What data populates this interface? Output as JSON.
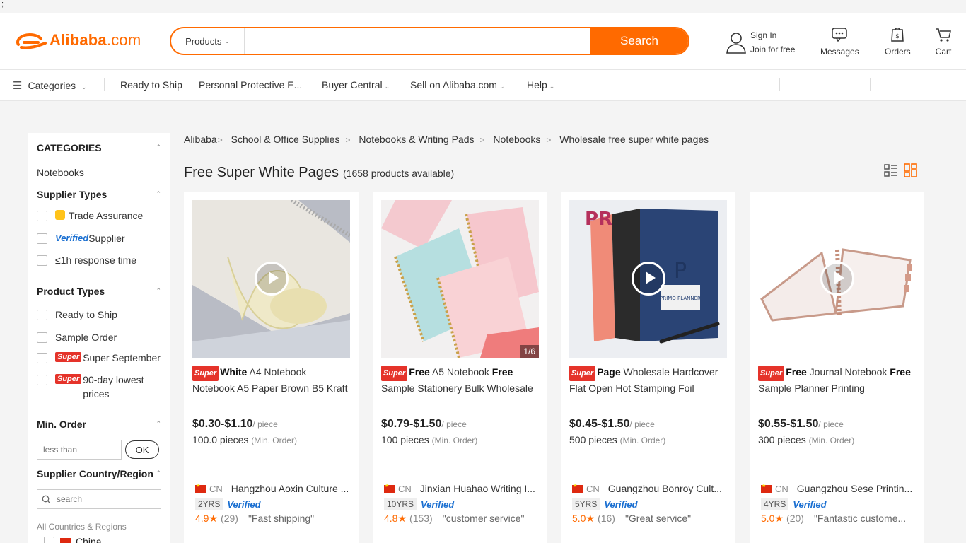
{
  "top_strip": ";",
  "header": {
    "logo_text": "Alibaba",
    "logo_suffix": ".com",
    "search_category": "Products",
    "search_value": "",
    "search_button": "Search",
    "sign_in": "Sign In",
    "join": "Join for free",
    "messages": "Messages",
    "orders": "Orders",
    "cart": "Cart"
  },
  "nav": {
    "categories": "Categories",
    "items": [
      "Ready to Ship",
      "Personal Protective E...",
      "Buyer Central",
      "Sell on Alibaba.com",
      "Help"
    ]
  },
  "sidebar": {
    "categories_title": "CATEGORIES",
    "category_item": "Notebooks",
    "supplier_types_title": "Supplier Types",
    "supplier_types": {
      "trade_assurance": "Trade Assurance",
      "verified_word": "Verified",
      "supplier": " Supplier",
      "response": "≤1h response time"
    },
    "product_types_title": "Product Types",
    "product_types": {
      "ready": "Ready to Ship",
      "sample": "Sample Order",
      "super_tag": "Super",
      "super_sept": "Super September",
      "lowest": "90-day lowest prices"
    },
    "min_order_title": "Min. Order",
    "min_order_placeholder": "less than",
    "ok": "OK",
    "country_title": "Supplier Country/Region",
    "country_placeholder": "search",
    "all_countries": "All Countries & Regions",
    "china": "China"
  },
  "breadcrumb": {
    "root": "Alibaba",
    "items": [
      "School & Office Supplies",
      "Notebooks & Writing Pads",
      "Notebooks",
      "Wholesale free super white pages"
    ]
  },
  "page": {
    "title": "Free Super White Pages",
    "count": "(1658 products available)"
  },
  "colors": {
    "accent": "#ff6a00",
    "super_red": "#e5332a",
    "verified_blue": "#1a6fd1"
  },
  "products": [
    {
      "super_tag": "Super",
      "title_bold": "White",
      "title_rest": " A4 Notebook Notebook A5 Paper Brown B5 Kraft",
      "price": "$0.30-$1.10",
      "unit": "/ piece",
      "moq": "100.0 pieces",
      "moq_label": "(Min. Order)",
      "country": "CN",
      "supplier": "Hangzhou Aoxin Culture ...",
      "years": "2YRS",
      "verified": "Verified",
      "score": "4.9",
      "reviews": "(29)",
      "quote": "\"Fast shipping\"",
      "page_indicator": ""
    },
    {
      "super_tag": "Super",
      "title_bold": "Free",
      "title_rest": " A5 Notebook ",
      "title_bold2": "Free",
      "title_rest2": " Sample Stationery Bulk Wholesale",
      "price": "$0.79-$1.50",
      "unit": "/ piece",
      "moq": "100 pieces",
      "moq_label": "(Min. Order)",
      "country": "CN",
      "supplier": "Jinxian Huahao Writing I...",
      "years": "10YRS",
      "verified": "Verified",
      "score": "4.8",
      "reviews": "(153)",
      "quote": "\"customer service\"",
      "page_indicator": "1/6"
    },
    {
      "super_tag": "Super",
      "title_bold": "Page",
      "title_rest": " Wholesale Hardcover Flat Open Hot Stamping Foil",
      "price": "$0.45-$1.50",
      "unit": "/ piece",
      "moq": "500 pieces",
      "moq_label": "(Min. Order)",
      "country": "CN",
      "supplier": "Guangzhou Bonroy Cult...",
      "years": "5YRS",
      "verified": "Verified",
      "score": "5.0",
      "reviews": "(16)",
      "quote": "\"Great service\"",
      "page_indicator": "",
      "brand_letter": "PR",
      "brand_word": "PRIMO PLANNER"
    },
    {
      "super_tag": "Super",
      "title_bold": "Free",
      "title_rest": " Journal Notebook ",
      "title_bold2": "Free",
      "title_rest2": " Sample Planner Printing",
      "price": "$0.55-$1.50",
      "unit": "/ piece",
      "moq": "300 pieces",
      "moq_label": "(Min. Order)",
      "country": "CN",
      "supplier": "Guangzhou Sese Printin...",
      "years": "4YRS",
      "verified": "Verified",
      "score": "5.0",
      "reviews": "(20)",
      "quote": "\"Fantastic custome...",
      "page_indicator": ""
    }
  ]
}
